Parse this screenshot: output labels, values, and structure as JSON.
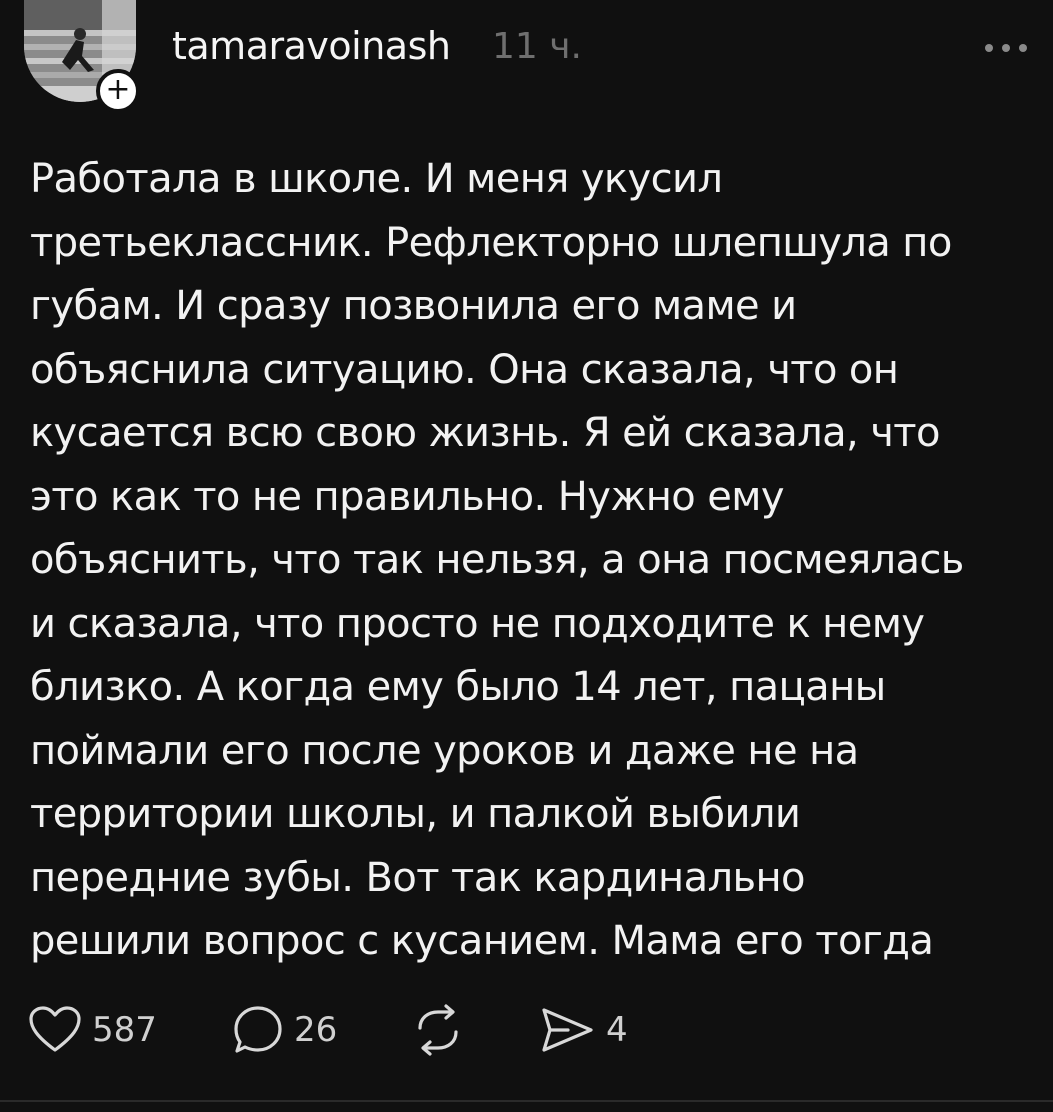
{
  "post": {
    "username": "tamaravoinash",
    "time": "11 ч.",
    "follow_label": "+",
    "more_label": "•••",
    "text_lines": [
      "Работала в школе. И меня укусил",
      "третьеклассник. Рефлекторно шлепшула по",
      "губам. И сразу позвонила его маме и",
      "объяснила ситуацию. Она сказала, что он",
      "кусается всю свою жизнь. Я ей сказала, что",
      "это как то не правильно. Нужно ему",
      "объяснить, что так нельзя, а она посмеялась",
      "и сказала, что просто не подходите к нему",
      "близко. А когда ему было 14 лет, пацаны",
      "поймали его после уроков и даже не на",
      "территории школы, и палкой выбили",
      "передние зубы. Вот так кардинально",
      "решили вопрос с кусанием. Мама его тогда"
    ]
  },
  "actions": {
    "likes": "587",
    "comments": "26",
    "shares": "4",
    "icons": [
      "heart-icon",
      "comment-icon",
      "repost-icon",
      "share-icon"
    ]
  },
  "colors": {
    "background": "#101010",
    "text": "#f2f2f2",
    "muted": "#6f6f6f"
  }
}
